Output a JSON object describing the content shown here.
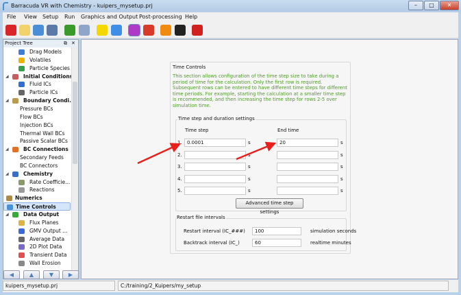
{
  "window": {
    "title": "Barracuda VR with Chemistry - kuipers_mysetup.prj",
    "minimize": "–",
    "maximize": "□",
    "close": "✕"
  },
  "menu": [
    "File",
    "View",
    "Setup",
    "Run",
    "Graphics and Output",
    "Post-processing",
    "Help"
  ],
  "toolbar": [
    {
      "icon": "power-icon",
      "color": "#d8262b"
    },
    {
      "icon": "new-file-icon",
      "color": "#f2d36b"
    },
    {
      "icon": "open-folder-icon",
      "color": "#4a8ed8"
    },
    {
      "icon": "save-icon",
      "color": "#5b7aa8"
    },
    {
      "icon": "particle-icon",
      "color": "#3a9a2a"
    },
    {
      "icon": "gear-icon",
      "color": "#8fa6c8"
    },
    {
      "icon": "step-one-icon",
      "color": "#f4d800"
    },
    {
      "icon": "arrow-right-icon",
      "color": "#3f8fe6"
    },
    {
      "icon": "splatter-icon",
      "color": "#b03ac8"
    },
    {
      "icon": "pacman-icon",
      "color": "#d83a2a"
    },
    {
      "icon": "flame-icon",
      "color": "#f08a10"
    },
    {
      "icon": "terminal-icon",
      "color": "#222222"
    },
    {
      "icon": "grid-icon",
      "color": "#d02020"
    }
  ],
  "tree": {
    "title": "Project Tree",
    "items": [
      {
        "label": "Drag Models",
        "level": 2,
        "icon": "#3b7fd6"
      },
      {
        "label": "Volatiles",
        "level": 2,
        "icon": "#f0b400"
      },
      {
        "label": "Particle Species",
        "level": 2,
        "icon": "#35a04a"
      },
      {
        "label": "Initial Conditions",
        "level": 1,
        "bold": true,
        "icon": "#c06060"
      },
      {
        "label": "Fluid ICs",
        "level": 2,
        "icon": "#2f6fd6"
      },
      {
        "label": "Particle ICs",
        "level": 2,
        "icon": "#666666"
      },
      {
        "label": "Boundary Condi...",
        "level": 1,
        "bold": true,
        "icon": "#b89a50"
      },
      {
        "label": "Pressure BCs",
        "level": 3
      },
      {
        "label": "Flow BCs",
        "level": 3
      },
      {
        "label": "Injection BCs",
        "level": 3
      },
      {
        "label": "Thermal Wall BCs",
        "level": 3
      },
      {
        "label": "Passive Scalar BCs",
        "level": 3
      },
      {
        "label": "BC Connections",
        "level": 1,
        "bold": true,
        "icon": "#e0702a"
      },
      {
        "label": "Secondary Feeds",
        "level": 3
      },
      {
        "label": "BC Connectors",
        "level": 3
      },
      {
        "label": "Chemistry",
        "level": 1,
        "bold": true,
        "icon": "#3b6fc0"
      },
      {
        "label": "Rate Coefficie...",
        "level": 2,
        "icon": "#8a9a6a"
      },
      {
        "label": "Reactions",
        "level": 2,
        "icon": "#999999"
      },
      {
        "label": "Numerics",
        "level": 0,
        "bold": true,
        "icon": "#b08a40"
      },
      {
        "label": "Time Controls",
        "level": 0,
        "bold": true,
        "icon": "#4a90d8",
        "selected": true
      },
      {
        "label": "Data Output",
        "level": 1,
        "bold": true,
        "icon": "#3aa83a"
      },
      {
        "label": "Flux Planes",
        "level": 2,
        "icon": "#e0b040"
      },
      {
        "label": "GMV Output ...",
        "level": 2,
        "icon": "#3a6ad8"
      },
      {
        "label": "Average Data",
        "level": 2,
        "icon": "#666666"
      },
      {
        "label": "2D Plot Data",
        "level": 2,
        "icon": "#7a6ac8"
      },
      {
        "label": "Transient Data",
        "level": 2,
        "icon": "#e05050"
      },
      {
        "label": "Wall Erosion",
        "level": 2,
        "icon": "#888888"
      }
    ]
  },
  "nav_buttons": [
    "◀",
    "▲",
    "▼",
    "▶"
  ],
  "status": {
    "project": "kuipers_mysetup.prj",
    "path": "C:/training/2_Kuipers/my_setup"
  },
  "time_controls": {
    "title": "Time Controls",
    "description": "This section allows configuration of the time step size to take during a period of time for the calculation. Only the first row is required. Subsequent rows can be entered to have different time steps for different time periods. For example, starting the calculation at a smaller time step is recommended, and then increasing the time step for rows 2-5 over simulation time.",
    "group_title": "Time step and duration settings",
    "col_time_step": "Time step",
    "col_end_time": "End time",
    "rows": [
      {
        "n": "1.",
        "step": "0.0001",
        "end": "20",
        "unit": "s"
      },
      {
        "n": "2.",
        "step": "",
        "end": "",
        "unit": "s"
      },
      {
        "n": "3.",
        "step": "",
        "end": "",
        "unit": "s"
      },
      {
        "n": "4.",
        "step": "",
        "end": "",
        "unit": "s"
      },
      {
        "n": "5.",
        "step": "",
        "end": "",
        "unit": "s"
      }
    ],
    "advanced_button": "Advanced time step settings",
    "restart_title": "Restart file intervals",
    "restart_label": "Restart interval (IC_###)",
    "restart_value": "100",
    "restart_unit": "simulation seconds",
    "backtrack_label": "Backtrack interval (IC_)",
    "backtrack_value": "60",
    "backtrack_unit": "realtime minutes"
  },
  "annotation_color": "#e8201c"
}
